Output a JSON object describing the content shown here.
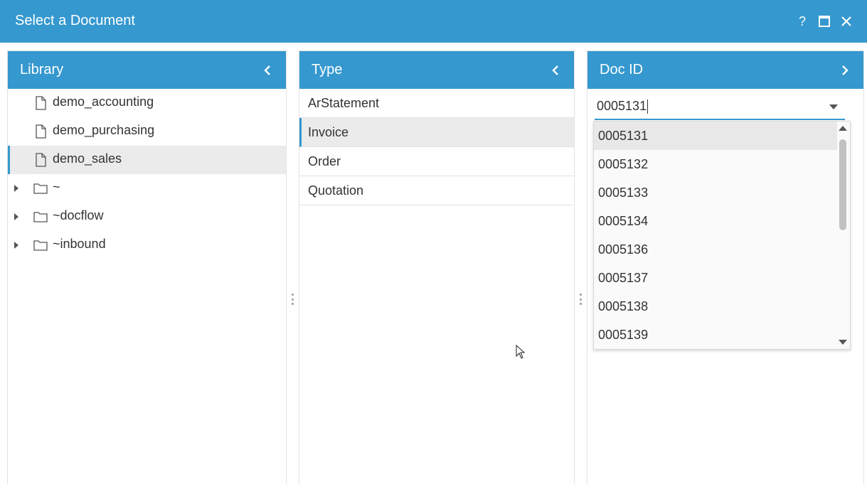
{
  "window": {
    "title": "Select a Document",
    "help_glyph": "?",
    "maximize_glyph": "□",
    "close_glyph": "✕"
  },
  "library": {
    "title": "Library",
    "items": [
      {
        "label": "demo_accounting",
        "icon": "file-icon"
      },
      {
        "label": "demo_purchasing",
        "icon": "file-icon"
      },
      {
        "label": "demo_sales",
        "icon": "file-icon",
        "selected": true
      },
      {
        "label": "~",
        "icon": "folder-icon",
        "expandable": true
      },
      {
        "label": "~docflow",
        "icon": "folder-icon",
        "expandable": true
      },
      {
        "label": "~inbound",
        "icon": "folder-icon",
        "expandable": true
      }
    ]
  },
  "type": {
    "title": "Type",
    "items": [
      {
        "label": "ArStatement"
      },
      {
        "label": "Invoice",
        "selected": true
      },
      {
        "label": "Order"
      },
      {
        "label": "Quotation"
      }
    ]
  },
  "docid": {
    "title": "Doc ID",
    "input_value": "0005131",
    "options": [
      "0005131",
      "0005132",
      "0005133",
      "0005134",
      "0005136",
      "0005137",
      "0005138",
      "0005139"
    ],
    "selected_option": "0005131"
  },
  "colors": {
    "accent": "#3598cf",
    "selected_bg": "#ebebeb"
  }
}
